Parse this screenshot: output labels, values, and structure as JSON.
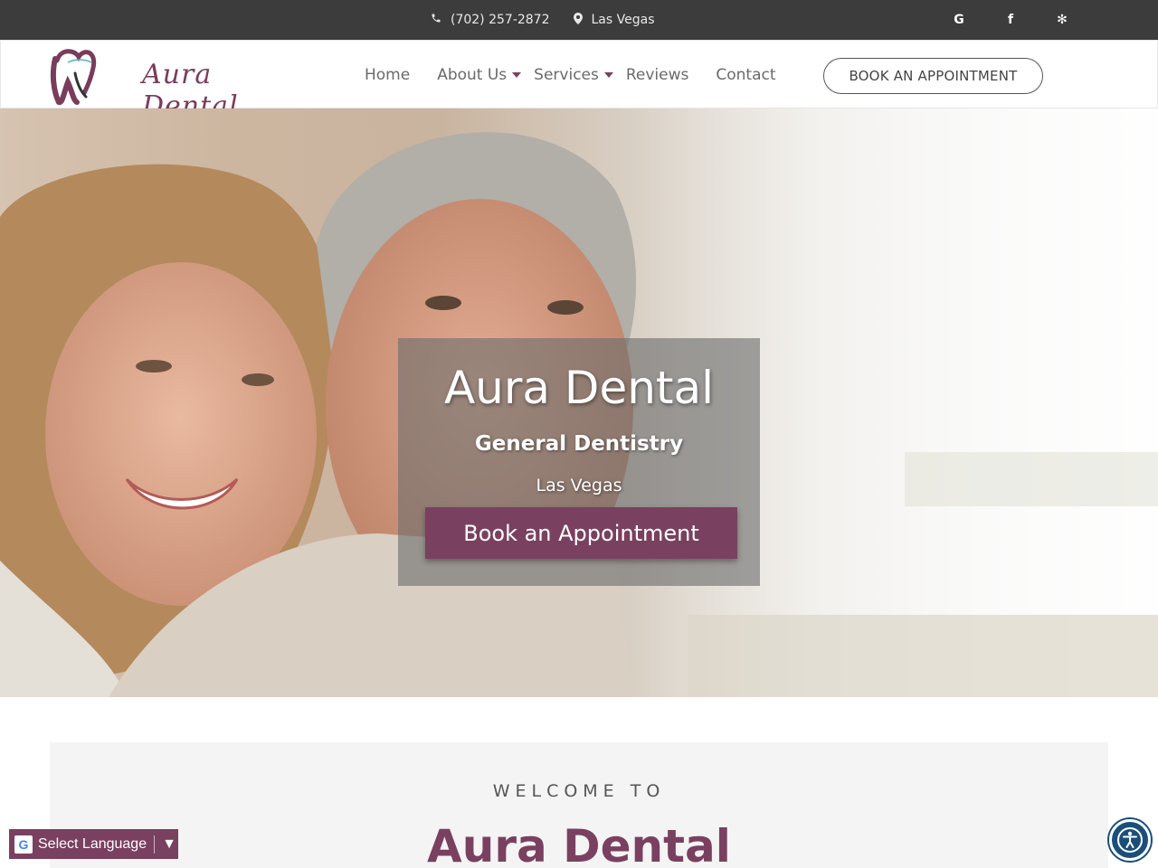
{
  "topbar": {
    "phone": "(702) 257-2872",
    "location": "Las Vegas",
    "phone_icon": "phone-icon",
    "location_icon": "map-pin-icon",
    "socials": [
      {
        "icon": "google-icon",
        "glyph": "G"
      },
      {
        "icon": "facebook-icon",
        "glyph": "f"
      },
      {
        "icon": "yelp-icon",
        "glyph": "✻"
      }
    ]
  },
  "header": {
    "logo_text": "Aura Dental",
    "nav": [
      {
        "label": "Home",
        "has_dropdown": false
      },
      {
        "label": "About Us",
        "has_dropdown": true
      },
      {
        "label": "Services",
        "has_dropdown": true
      },
      {
        "label": "Reviews",
        "has_dropdown": false
      },
      {
        "label": "Contact",
        "has_dropdown": false
      }
    ],
    "book_button": "BOOK AN APPOINTMENT"
  },
  "hero": {
    "title": "Aura Dental",
    "subtitle": "General Dentistry",
    "location": "Las Vegas",
    "cta": "Book an Appointment"
  },
  "welcome": {
    "kicker": "WELCOME TO",
    "title": "Aura Dental"
  },
  "language_widget": {
    "label": "Select Language",
    "arrow": "▼"
  },
  "colors": {
    "brand": "#7a4060",
    "topbar": "#3c3c3c",
    "accessibility": "#1b4f7a"
  }
}
